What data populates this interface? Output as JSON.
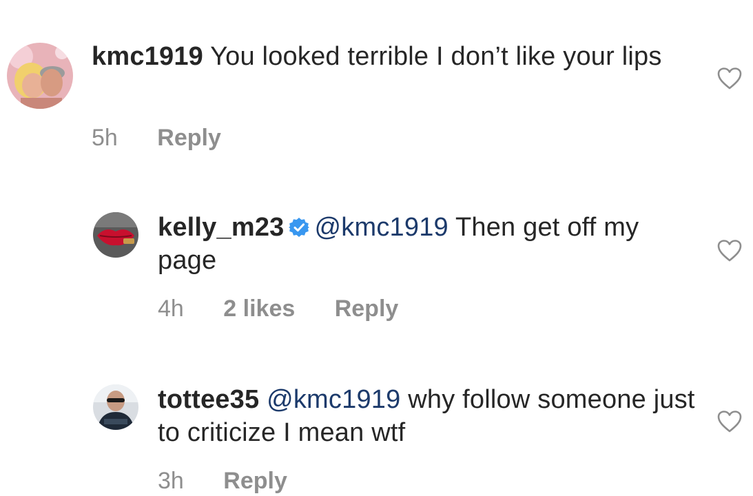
{
  "comments": [
    {
      "username": "kmc1919",
      "mention": "",
      "body": "You looked terrible I don’t like your lips",
      "time": "5h",
      "likes": "",
      "reply_label": "Reply",
      "verified": false,
      "avatar_icon": "couple-photo-avatar"
    },
    {
      "username": "kelly_m23",
      "mention": "@kmc1919",
      "body": "Then get off my page",
      "time": "4h",
      "likes": "2 likes",
      "reply_label": "Reply",
      "verified": true,
      "avatar_icon": "lips-avatar"
    },
    {
      "username": "tottee35",
      "mention": "@kmc1919",
      "body": "why follow someone just to criticize I mean wtf",
      "time": "3h",
      "likes": "",
      "reply_label": "Reply",
      "verified": false,
      "avatar_icon": "man-sunglasses-avatar"
    }
  ],
  "colors": {
    "text": "#262626",
    "meta": "#8e8e8e",
    "mention": "#1c3a6b",
    "verified": "#3897f0"
  },
  "icons": {
    "like": "heart-outline-icon",
    "verified": "verified-badge-icon"
  }
}
